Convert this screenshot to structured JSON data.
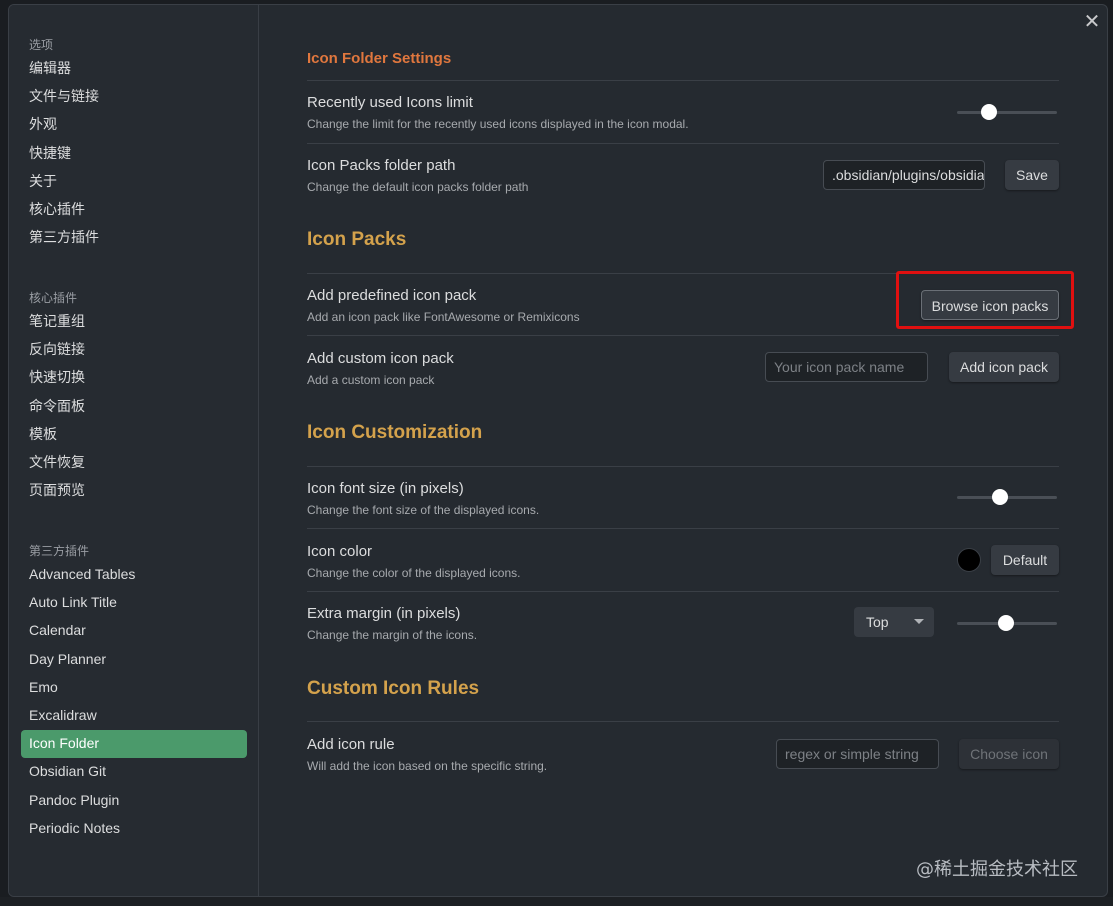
{
  "sidebar": {
    "options": {
      "heading": "选项",
      "items": [
        "编辑器",
        "文件与链接",
        "外观",
        "快捷键",
        "关于",
        "核心插件",
        "第三方插件"
      ]
    },
    "core": {
      "heading": "核心插件",
      "items": [
        "笔记重组",
        "反向链接",
        "快速切换",
        "命令面板",
        "模板",
        "文件恢复",
        "页面预览"
      ]
    },
    "community": {
      "heading": "第三方插件",
      "items": [
        "Advanced Tables",
        "Auto Link Title",
        "Calendar",
        "Day Planner",
        "Emo",
        "Excalidraw",
        "Icon Folder",
        "Obsidian Git",
        "Pandoc Plugin",
        "Periodic Notes"
      ],
      "active": "Icon Folder"
    }
  },
  "close_icon": "✕",
  "settings": {
    "title": "Icon Folder Settings",
    "recent_limit": {
      "name": "Recently used Icons limit",
      "desc": "Change the limit for the recently used icons displayed in the icon modal.",
      "slider_fraction": 0.32
    },
    "packs_path": {
      "name": "Icon Packs folder path",
      "desc": "Change the default icon packs folder path",
      "value": ".obsidian/plugins/obsidian-icon-folder/icons",
      "save_label": "Save"
    }
  },
  "icon_packs": {
    "title": "Icon Packs",
    "predefined": {
      "name": "Add predefined icon pack",
      "desc": "Add an icon pack like FontAwesome or Remixicons",
      "button_label": "Browse icon packs"
    },
    "custom": {
      "name": "Add custom icon pack",
      "desc": "Add a custom icon pack",
      "placeholder": "Your icon pack name",
      "button_label": "Add icon pack"
    }
  },
  "customization": {
    "title": "Icon Customization",
    "font_size": {
      "name": "Icon font size (in pixels)",
      "desc": "Change the font size of the displayed icons.",
      "slider_fraction": 0.43
    },
    "color": {
      "name": "Icon color",
      "desc": "Change the color of the displayed icons.",
      "swatch_color": "#000000",
      "default_label": "Default"
    },
    "margin": {
      "name": "Extra margin (in pixels)",
      "desc": "Change the margin of the icons.",
      "select_value": "Top",
      "slider_fraction": 0.49
    }
  },
  "rules": {
    "title": "Custom Icon Rules",
    "add_rule": {
      "name": "Add icon rule",
      "desc": "Will add the icon based on the specific string.",
      "placeholder": "regex or simple string",
      "button_label": "Choose icon"
    }
  },
  "watermark": "@稀土掘金技术社区",
  "colors": {
    "accent_active": "#4b9a6b",
    "section_title": "#d4a24c",
    "highlight_box": "#e01010"
  }
}
